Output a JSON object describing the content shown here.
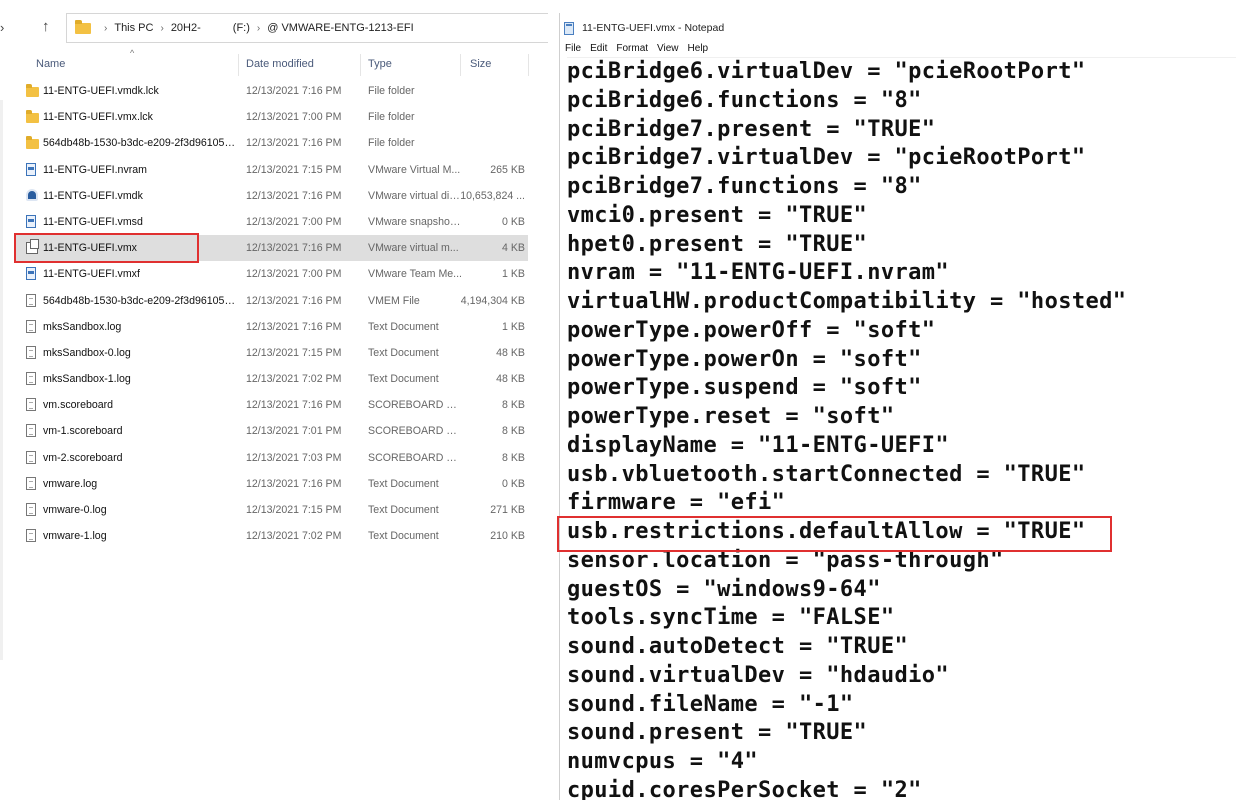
{
  "explorer": {
    "address_parts": [
      "This PC",
      "20H2-",
      "(F:)",
      "@ VMWARE-ENTG-1213-EFI"
    ],
    "columns": {
      "name": "Name",
      "date": "Date modified",
      "type": "Type",
      "size": "Size"
    },
    "files": [
      {
        "name": "11-ENTG-UEFI.vmdk.lck",
        "date": "12/13/2021 7:16 PM",
        "type": "File folder",
        "size": "",
        "icon": "folder-icon"
      },
      {
        "name": "11-ENTG-UEFI.vmx.lck",
        "date": "12/13/2021 7:00 PM",
        "type": "File folder",
        "size": "",
        "icon": "folder-icon"
      },
      {
        "name": "564db48b-1530-b3dc-e209-2f3d96105d61...",
        "date": "12/13/2021 7:16 PM",
        "type": "File folder",
        "size": "",
        "icon": "folder-icon"
      },
      {
        "name": "11-ENTG-UEFI.nvram",
        "date": "12/13/2021 7:15 PM",
        "type": "VMware Virtual M...",
        "size": "265 KB",
        "icon": "vmware-file-icon"
      },
      {
        "name": "11-ENTG-UEFI.vmdk",
        "date": "12/13/2021 7:16 PM",
        "type": "VMware virtual dis...",
        "size": "10,653,824 ...",
        "icon": "virtual-disk-icon"
      },
      {
        "name": "11-ENTG-UEFI.vmsd",
        "date": "12/13/2021 7:00 PM",
        "type": "VMware snapshot ...",
        "size": "0 KB",
        "icon": "vmware-file-icon"
      },
      {
        "name": "11-ENTG-UEFI.vmx",
        "date": "12/13/2021 7:16 PM",
        "type": "VMware virtual m...",
        "size": "4 KB",
        "icon": "vm-config-icon",
        "selected": true
      },
      {
        "name": "11-ENTG-UEFI.vmxf",
        "date": "12/13/2021 7:00 PM",
        "type": "VMware Team Me...",
        "size": "1 KB",
        "icon": "vmware-file-icon"
      },
      {
        "name": "564db48b-1530-b3dc-e209-2f3d96105d61...",
        "date": "12/13/2021 7:16 PM",
        "type": "VMEM File",
        "size": "4,194,304 KB",
        "icon": "document-icon"
      },
      {
        "name": "mksSandbox.log",
        "date": "12/13/2021 7:16 PM",
        "type": "Text Document",
        "size": "1 KB",
        "icon": "text-document-icon"
      },
      {
        "name": "mksSandbox-0.log",
        "date": "12/13/2021 7:15 PM",
        "type": "Text Document",
        "size": "48 KB",
        "icon": "text-document-icon"
      },
      {
        "name": "mksSandbox-1.log",
        "date": "12/13/2021 7:02 PM",
        "type": "Text Document",
        "size": "48 KB",
        "icon": "text-document-icon"
      },
      {
        "name": "vm.scoreboard",
        "date": "12/13/2021 7:16 PM",
        "type": "SCOREBOARD File",
        "size": "8 KB",
        "icon": "document-icon"
      },
      {
        "name": "vm-1.scoreboard",
        "date": "12/13/2021 7:01 PM",
        "type": "SCOREBOARD File",
        "size": "8 KB",
        "icon": "document-icon"
      },
      {
        "name": "vm-2.scoreboard",
        "date": "12/13/2021 7:03 PM",
        "type": "SCOREBOARD File",
        "size": "8 KB",
        "icon": "document-icon"
      },
      {
        "name": "vmware.log",
        "date": "12/13/2021 7:16 PM",
        "type": "Text Document",
        "size": "0 KB",
        "icon": "text-document-icon"
      },
      {
        "name": "vmware-0.log",
        "date": "12/13/2021 7:15 PM",
        "type": "Text Document",
        "size": "271 KB",
        "icon": "text-document-icon"
      },
      {
        "name": "vmware-1.log",
        "date": "12/13/2021 7:02 PM",
        "type": "Text Document",
        "size": "210 KB",
        "icon": "text-document-icon"
      }
    ]
  },
  "notepad": {
    "title": "11-ENTG-UEFI.vmx - Notepad",
    "menu": [
      "File",
      "Edit",
      "Format",
      "View",
      "Help"
    ],
    "lines": [
      "pciBridge6.virtualDev = \"pcieRootPort\"",
      "pciBridge6.functions = \"8\"",
      "pciBridge7.present = \"TRUE\"",
      "pciBridge7.virtualDev = \"pcieRootPort\"",
      "pciBridge7.functions = \"8\"",
      "vmci0.present = \"TRUE\"",
      "hpet0.present = \"TRUE\"",
      "nvram = \"11-ENTG-UEFI.nvram\"",
      "virtualHW.productCompatibility = \"hosted\"",
      "powerType.powerOff = \"soft\"",
      "powerType.powerOn = \"soft\"",
      "powerType.suspend = \"soft\"",
      "powerType.reset = \"soft\"",
      "displayName = \"11-ENTG-UEFI\"",
      "usb.vbluetooth.startConnected = \"TRUE\"",
      "firmware = \"efi\"",
      "usb.restrictions.defaultAllow = \"TRUE\"",
      "sensor.location = \"pass-through\"",
      "guestOS = \"windows9-64\"",
      "tools.syncTime = \"FALSE\"",
      "sound.autoDetect = \"TRUE\"",
      "sound.virtualDev = \"hdaudio\"",
      "sound.fileName = \"-1\"",
      "sound.present = \"TRUE\"",
      "numvcpus = \"4\"",
      "cpuid.coresPerSocket = \"2\""
    ]
  },
  "highlight_color": "#e03030"
}
